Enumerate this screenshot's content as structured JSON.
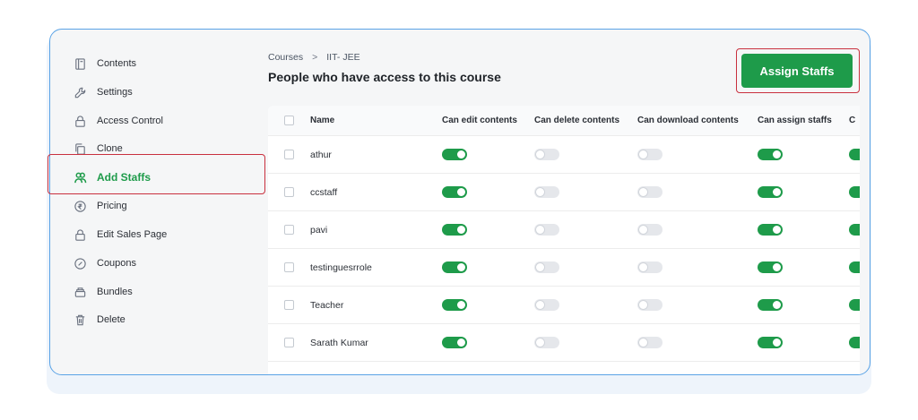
{
  "sidebar": {
    "items": [
      {
        "label": "Contents",
        "icon": "book-icon"
      },
      {
        "label": "Settings",
        "icon": "wrench-icon"
      },
      {
        "label": "Access Control",
        "icon": "lock-icon"
      },
      {
        "label": "Clone",
        "icon": "copy-icon"
      },
      {
        "label": "Add Staffs",
        "icon": "users-icon",
        "active": true
      },
      {
        "label": "Pricing",
        "icon": "rupee-icon"
      },
      {
        "label": "Edit Sales Page",
        "icon": "lock-icon"
      },
      {
        "label": "Coupons",
        "icon": "coupon-icon"
      },
      {
        "label": "Bundles",
        "icon": "bundle-icon"
      },
      {
        "label": "Delete",
        "icon": "trash-icon"
      }
    ]
  },
  "header": {
    "breadcrumb": [
      "Courses",
      "IIT- JEE"
    ],
    "breadcrumb_sep": ">",
    "title": "People who have access to this course",
    "assign_button": "Assign Staffs"
  },
  "table": {
    "columns": [
      "Name",
      "Can edit contents",
      "Can delete contents",
      "Can download contents",
      "Can assign staffs",
      "C"
    ],
    "rows": [
      {
        "name": "athur",
        "perms": [
          true,
          false,
          false,
          true,
          true
        ]
      },
      {
        "name": "ccstaff",
        "perms": [
          true,
          false,
          false,
          true,
          true
        ]
      },
      {
        "name": "pavi",
        "perms": [
          true,
          false,
          false,
          true,
          true
        ]
      },
      {
        "name": "testinguesrrole",
        "perms": [
          true,
          false,
          false,
          true,
          true
        ]
      },
      {
        "name": "Teacher",
        "perms": [
          true,
          false,
          false,
          true,
          true
        ]
      },
      {
        "name": "Sarath Kumar",
        "perms": [
          true,
          false,
          false,
          true,
          true
        ]
      }
    ]
  },
  "colors": {
    "accent": "#1e9b4a",
    "highlight": "#c9303e",
    "frame_border": "#5aa3e6"
  }
}
